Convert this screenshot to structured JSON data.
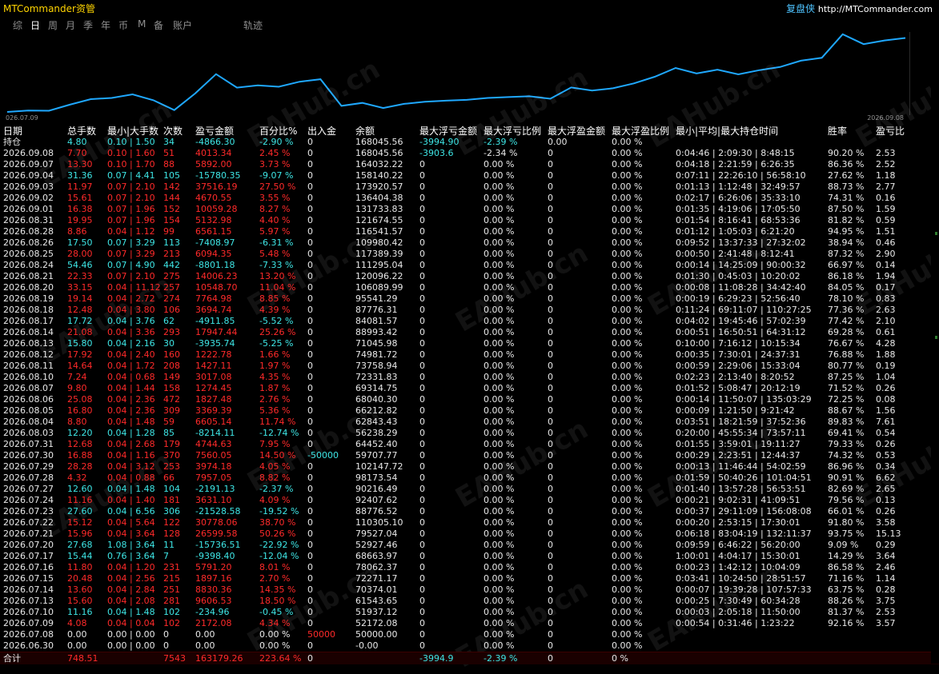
{
  "app": {
    "title": "MTCommander资管",
    "brand_label": "复盘侠",
    "brand_url": "http://MTCommander.com"
  },
  "tabs": [
    "综",
    "日",
    "周",
    "月",
    "季",
    "年",
    "币",
    "M",
    "备",
    "账户",
    "轨迹"
  ],
  "active_tab": "日",
  "chart": {
    "start_label": "026.07.09",
    "end_label": "2026.09.08",
    "line_color": "#1fa8ff",
    "equity_series": [
      50000,
      52172.08,
      51937.12,
      61543.65,
      70374.01,
      72271.17,
      78062.37,
      68663.97,
      52927.46,
      79527.04,
      110305.1,
      88776.52,
      92407.62,
      90216.49,
      98173.54,
      102147.72,
      59707.77,
      64452.4,
      56238.29,
      62843.43,
      66212.82,
      68040.3,
      69314.75,
      72331.83,
      73758.94,
      74981.72,
      71045.98,
      88993.42,
      84081.57,
      87776.31,
      95541.29,
      106089.99,
      120096.22,
      111295.04,
      117389.39,
      109980.42,
      116541.57,
      121674.55,
      131733.83,
      136404.38,
      173920.57,
      158140.22,
      164032.22,
      168045.56
    ]
  },
  "watermark": "EAHub.cn",
  "table": {
    "headers": [
      "日期",
      "总手数",
      "最小|大手数",
      "次数",
      "盈亏金额",
      "百分比%",
      "出入金",
      "余额",
      "最大浮亏金额",
      "最大浮亏比例",
      "最大浮盈金额",
      "最大浮盈比例",
      "最小|平均|最大持仓时间",
      "胜率",
      "盈亏比"
    ],
    "holding": {
      "date": "持仓",
      "lots": "4.80",
      "minmax": "0.10 | 1.50",
      "count": "34",
      "pl": "-4866.30",
      "pct": "-2.90 %",
      "io": "0",
      "balance": "168045.56",
      "maxloss": "-3994.90",
      "maxloss_pct": "-2.39 %",
      "maxgain": "0.00",
      "maxgain_pct": "0.00 %"
    },
    "rows": [
      [
        "2026.09.08",
        "7.70",
        "0.10 | 1.60",
        "51",
        "4013.34",
        "2.45 %",
        "0",
        "168045.56",
        "-3903.6",
        "-2.34 %",
        "0",
        "0.00 %",
        "0:04:46 | 2:09:30 | 8:48:15",
        "90.20 %",
        "2.53"
      ],
      [
        "2026.09.07",
        "13.30",
        "0.10 | 1.70",
        "88",
        "5892.00",
        "3.73 %",
        "0",
        "164032.22",
        "0",
        "0.00 %",
        "0",
        "0.00 %",
        "0:04:18 | 2:21:59 | 6:26:35",
        "86.36 %",
        "2.52"
      ],
      [
        "2026.09.04",
        "31.36",
        "0.07 | 4.41",
        "105",
        "-15780.35",
        "-9.07 %",
        "0",
        "158140.22",
        "0",
        "0.00 %",
        "0",
        "0.00 %",
        "0:07:11 | 22:26:10 | 56:58:10",
        "27.62 %",
        "1.18"
      ],
      [
        "2026.09.03",
        "11.97",
        "0.07 | 2.10",
        "142",
        "37516.19",
        "27.50 %",
        "0",
        "173920.57",
        "0",
        "0.00 %",
        "0",
        "0.00 %",
        "0:01:13 | 1:12:48 | 32:49:57",
        "88.73 %",
        "2.77"
      ],
      [
        "2026.09.02",
        "15.61",
        "0.07 | 2.10",
        "144",
        "4670.55",
        "3.55 %",
        "0",
        "136404.38",
        "0",
        "0.00 %",
        "0",
        "0.00 %",
        "0:02:17 | 6:26:06 | 35:33:10",
        "74.31 %",
        "0.16"
      ],
      [
        "2026.09.01",
        "16.38",
        "0.07 | 1.96",
        "152",
        "10059.28",
        "8.27 %",
        "0",
        "131733.83",
        "0",
        "0.00 %",
        "0",
        "0.00 %",
        "0:01:35 | 4:19:06 | 17:05:50",
        "87.50 %",
        "1.59"
      ],
      [
        "2026.08.31",
        "19.95",
        "0.07 | 1.96",
        "154",
        "5132.98",
        "4.40 %",
        "0",
        "121674.55",
        "0",
        "0.00 %",
        "0",
        "0.00 %",
        "0:01:54 | 8:16:41 | 68:53:36",
        "81.82 %",
        "0.59"
      ],
      [
        "2026.08.28",
        "8.86",
        "0.04 | 1.12",
        "99",
        "6561.15",
        "5.97 %",
        "0",
        "116541.57",
        "0",
        "0.00 %",
        "0",
        "0.00 %",
        "0:01:12 | 1:05:03 | 6:21:20",
        "94.95 %",
        "1.51"
      ],
      [
        "2026.08.26",
        "17.50",
        "0.07 | 3.29",
        "113",
        "-7408.97",
        "-6.31 %",
        "0",
        "109980.42",
        "0",
        "0.00 %",
        "0",
        "0.00 %",
        "0:09:52 | 13:37:33 | 27:32:02",
        "38.94 %",
        "0.46"
      ],
      [
        "2026.08.25",
        "28.00",
        "0.07 | 3.29",
        "213",
        "6094.35",
        "5.48 %",
        "0",
        "117389.39",
        "0",
        "0.00 %",
        "0",
        "0.00 %",
        "0:00:50 | 2:41:48 | 8:12:41",
        "87.32 %",
        "2.90"
      ],
      [
        "2026.08.24",
        "54.46",
        "0.07 | 4.90",
        "442",
        "-8801.18",
        "-7.33 %",
        "0",
        "111295.04",
        "0",
        "0.00 %",
        "0",
        "0.00 %",
        "0:00:14 | 14:25:09 | 90:00:32",
        "66.97 %",
        "0.14"
      ],
      [
        "2026.08.21",
        "22.33",
        "0.07 | 2.10",
        "275",
        "14006.23",
        "13.20 %",
        "0",
        "120096.22",
        "0",
        "0.00 %",
        "0",
        "0.00 %",
        "0:01:30 | 0:45:03 | 10:20:02",
        "86.18 %",
        "1.94"
      ],
      [
        "2026.08.20",
        "33.15",
        "0.04 | 11.12",
        "257",
        "10548.70",
        "11.04 %",
        "0",
        "106089.99",
        "0",
        "0.00 %",
        "0",
        "0.00 %",
        "0:00:08 | 11:08:28 | 34:42:40",
        "84.05 %",
        "0.17"
      ],
      [
        "2026.08.19",
        "19.14",
        "0.04 | 2.72",
        "274",
        "7764.98",
        "8.85 %",
        "0",
        "95541.29",
        "0",
        "0.00 %",
        "0",
        "0.00 %",
        "0:00:19 | 6:29:23 | 52:56:40",
        "78.10 %",
        "0.83"
      ],
      [
        "2026.08.18",
        "12.48",
        "0.04 | 3.80",
        "106",
        "3694.74",
        "4.39 %",
        "0",
        "87776.31",
        "0",
        "0.00 %",
        "0",
        "0.00 %",
        "0:11:24 | 69:11:07 | 110:27:25",
        "77.36 %",
        "2.63"
      ],
      [
        "2026.08.17",
        "17.72",
        "0.04 | 3.76",
        "62",
        "-4911.85",
        "-5.52 %",
        "0",
        "84081.57",
        "0",
        "0.00 %",
        "0",
        "0.00 %",
        "0:04:02 | 19:45:46 | 57:02:39",
        "77.42 %",
        "2.10"
      ],
      [
        "2026.08.14",
        "21.08",
        "0.04 | 3.36",
        "293",
        "17947.44",
        "25.26 %",
        "0",
        "88993.42",
        "0",
        "0.00 %",
        "0",
        "0.00 %",
        "0:00:51 | 16:50:51 | 64:31:12",
        "69.28 %",
        "0.61"
      ],
      [
        "2026.08.13",
        "15.80",
        "0.04 | 2.16",
        "30",
        "-3935.74",
        "-5.25 %",
        "0",
        "71045.98",
        "0",
        "0.00 %",
        "0",
        "0.00 %",
        "0:10:00 | 7:16:12 | 10:15:34",
        "76.67 %",
        "4.28"
      ],
      [
        "2026.08.12",
        "17.92",
        "0.04 | 2.40",
        "160",
        "1222.78",
        "1.66 %",
        "0",
        "74981.72",
        "0",
        "0.00 %",
        "0",
        "0.00 %",
        "0:00:35 | 7:30:01 | 24:37:31",
        "76.88 %",
        "1.88"
      ],
      [
        "2026.08.11",
        "14.64",
        "0.04 | 1.72",
        "208",
        "1427.11",
        "1.97 %",
        "0",
        "73758.94",
        "0",
        "0.00 %",
        "0",
        "0.00 %",
        "0:00:59 | 2:29:06 | 15:33:04",
        "80.77 %",
        "0.19"
      ],
      [
        "2026.08.10",
        "7.24",
        "0.04 | 0.68",
        "149",
        "3017.08",
        "4.35 %",
        "0",
        "72331.83",
        "0",
        "0.00 %",
        "0",
        "0.00 %",
        "0:02:23 | 2:13:40 | 8:20:52",
        "87.25 %",
        "1.04"
      ],
      [
        "2026.08.07",
        "9.80",
        "0.04 | 1.44",
        "158",
        "1274.45",
        "1.87 %",
        "0",
        "69314.75",
        "0",
        "0.00 %",
        "0",
        "0.00 %",
        "0:01:52 | 5:08:47 | 20:12:19",
        "71.52 %",
        "0.26"
      ],
      [
        "2026.08.06",
        "25.08",
        "0.04 | 2.36",
        "472",
        "1827.48",
        "2.76 %",
        "0",
        "68040.30",
        "0",
        "0.00 %",
        "0",
        "0.00 %",
        "0:00:14 | 11:50:07 | 135:03:29",
        "72.25 %",
        "0.08"
      ],
      [
        "2026.08.05",
        "16.80",
        "0.04 | 2.36",
        "309",
        "3369.39",
        "5.36 %",
        "0",
        "66212.82",
        "0",
        "0.00 %",
        "0",
        "0.00 %",
        "0:00:09 | 1:21:50 | 9:21:42",
        "88.67 %",
        "1.56"
      ],
      [
        "2026.08.04",
        "8.80",
        "0.04 | 1.48",
        "59",
        "6605.14",
        "11.74 %",
        "0",
        "62843.43",
        "0",
        "0.00 %",
        "0",
        "0.00 %",
        "0:03:51 | 18:21:59 | 37:52:36",
        "89.83 %",
        "7.61"
      ],
      [
        "2026.08.03",
        "12.20",
        "0.04 | 1.28",
        "85",
        "-8214.11",
        "-12.74 %",
        "0",
        "56238.29",
        "0",
        "0.00 %",
        "0",
        "0.00 %",
        "0:20:00 | 45:55:34 | 73:57:11",
        "69.41 %",
        "0.54"
      ],
      [
        "2026.07.31",
        "12.68",
        "0.04 | 2.68",
        "179",
        "4744.63",
        "7.95 %",
        "0",
        "64452.40",
        "0",
        "0.00 %",
        "0",
        "0.00 %",
        "0:01:55 | 3:59:01 | 19:11:27",
        "79.33 %",
        "0.26"
      ],
      [
        "2026.07.30",
        "16.88",
        "0.04 | 1.16",
        "370",
        "7560.05",
        "14.50 %",
        "-50000",
        "59707.77",
        "0",
        "0.00 %",
        "0",
        "0.00 %",
        "0:00:29 | 2:23:51 | 12:44:37",
        "74.32 %",
        "0.53"
      ],
      [
        "2026.07.29",
        "28.28",
        "0.04 | 3.12",
        "253",
        "3974.18",
        "4.05 %",
        "0",
        "102147.72",
        "0",
        "0.00 %",
        "0",
        "0.00 %",
        "0:00:13 | 11:46:44 | 54:02:59",
        "86.96 %",
        "0.34"
      ],
      [
        "2026.07.28",
        "4.32",
        "0.04 | 0.88",
        "66",
        "7957.05",
        "8.82 %",
        "0",
        "98173.54",
        "0",
        "0.00 %",
        "0",
        "0.00 %",
        "0:01:59 | 50:40:26 | 101:04:51",
        "90.91 %",
        "6.62"
      ],
      [
        "2026.07.27",
        "12.60",
        "0.04 | 1.48",
        "104",
        "-2191.13",
        "-2.37 %",
        "0",
        "90216.49",
        "0",
        "0.00 %",
        "0",
        "0.00 %",
        "0:01:40 | 13:57:28 | 56:53:51",
        "82.69 %",
        "2.65"
      ],
      [
        "2026.07.24",
        "11.16",
        "0.04 | 1.40",
        "181",
        "3631.10",
        "4.09 %",
        "0",
        "92407.62",
        "0",
        "0.00 %",
        "0",
        "0.00 %",
        "0:00:21 | 9:02:31 | 41:09:51",
        "79.56 %",
        "0.13"
      ],
      [
        "2026.07.23",
        "27.60",
        "0.04 | 6.56",
        "306",
        "-21528.58",
        "-19.52 %",
        "0",
        "88776.52",
        "0",
        "0.00 %",
        "0",
        "0.00 %",
        "0:00:37 | 29:11:09 | 156:08:08",
        "66.01 %",
        "0.26"
      ],
      [
        "2026.07.22",
        "15.12",
        "0.04 | 5.64",
        "122",
        "30778.06",
        "38.70 %",
        "0",
        "110305.10",
        "0",
        "0.00 %",
        "0",
        "0.00 %",
        "0:00:20 | 2:53:15 | 17:30:01",
        "91.80 %",
        "3.58"
      ],
      [
        "2026.07.21",
        "15.96",
        "0.04 | 3.64",
        "128",
        "26599.58",
        "50.26 %",
        "0",
        "79527.04",
        "0",
        "0.00 %",
        "0",
        "0.00 %",
        "0:06:18 | 83:04:19 | 132:11:37",
        "93.75 %",
        "15.13"
      ],
      [
        "2026.07.20",
        "27.68",
        "1.08 | 3.64",
        "11",
        "-15736.51",
        "-22.92 %",
        "0",
        "52927.46",
        "0",
        "0.00 %",
        "0",
        "0.00 %",
        "0:09:59 | 6:46:22 | 56:20:00",
        "9.09 %",
        "0.29"
      ],
      [
        "2026.07.17",
        "15.44",
        "0.76 | 3.64",
        "7",
        "-9398.40",
        "-12.04 %",
        "0",
        "68663.97",
        "0",
        "0.00 %",
        "0",
        "0.00 %",
        "1:00:01 | 4:04:17 | 15:30:01",
        "14.29 %",
        "3.64"
      ],
      [
        "2026.07.16",
        "11.80",
        "0.04 | 1.20",
        "231",
        "5791.20",
        "8.01 %",
        "0",
        "78062.37",
        "0",
        "0.00 %",
        "0",
        "0.00 %",
        "0:00:23 | 1:42:12 | 10:04:09",
        "86.58 %",
        "2.46"
      ],
      [
        "2026.07.15",
        "20.48",
        "0.04 | 2.56",
        "215",
        "1897.16",
        "2.70 %",
        "0",
        "72271.17",
        "0",
        "0.00 %",
        "0",
        "0.00 %",
        "0:03:41 | 10:24:50 | 28:51:57",
        "71.16 %",
        "1.14"
      ],
      [
        "2026.07.14",
        "13.60",
        "0.04 | 2.84",
        "251",
        "8830.36",
        "14.35 %",
        "0",
        "70374.01",
        "0",
        "0.00 %",
        "0",
        "0.00 %",
        "0:00:07 | 19:39:28 | 107:57:33",
        "63.75 %",
        "0.28"
      ],
      [
        "2026.07.13",
        "15.60",
        "0.04 | 2.08",
        "281",
        "9606.53",
        "18.50 %",
        "0",
        "61543.65",
        "0",
        "0.00 %",
        "0",
        "0.00 %",
        "0:00:25 | 7:30:49 | 60:34:28",
        "88.26 %",
        "3.75"
      ],
      [
        "2026.07.10",
        "11.16",
        "0.04 | 1.48",
        "102",
        "-234.96",
        "-0.45 %",
        "0",
        "51937.12",
        "0",
        "0.00 %",
        "0",
        "0.00 %",
        "0:00:03 | 2:05:18 | 11:50:00",
        "81.37 %",
        "2.53"
      ],
      [
        "2026.07.09",
        "4.08",
        "0.04 | 0.04",
        "102",
        "2172.08",
        "4.34 %",
        "0",
        "52172.08",
        "0",
        "0.00 %",
        "0",
        "0.00 %",
        "0:00:54 | 0:31:46 | 1:23:22",
        "92.16 %",
        "3.57"
      ],
      [
        "2026.07.08",
        "0.00",
        "0.00 | 0.00",
        "0",
        "0.00",
        "0.00 %",
        "50000",
        "50000.00",
        "0",
        "0.00 %",
        "0",
        "0.00 %",
        "",
        "",
        ""
      ],
      [
        "2026.06.30",
        "0.00",
        "0.00 | 0.00",
        "0",
        "0.00",
        "0.00 %",
        "0",
        "-0.00",
        "0",
        "0.00 %",
        "0",
        "0.00 %",
        "",
        "",
        ""
      ]
    ],
    "total": {
      "label": "合计",
      "lots": "748.51",
      "count": "7543",
      "pl": "163179.26",
      "pct": "223.64 %",
      "io": "0",
      "maxloss": "-3994.9",
      "maxloss_pct": "-2.39 %",
      "maxgain": "0",
      "maxgain_pct": "0 %"
    }
  },
  "colors": {
    "positive": "#ff2a2a",
    "negative": "#3ee6e6",
    "neutral": "#e8e8e8",
    "title": "#ffd400"
  }
}
